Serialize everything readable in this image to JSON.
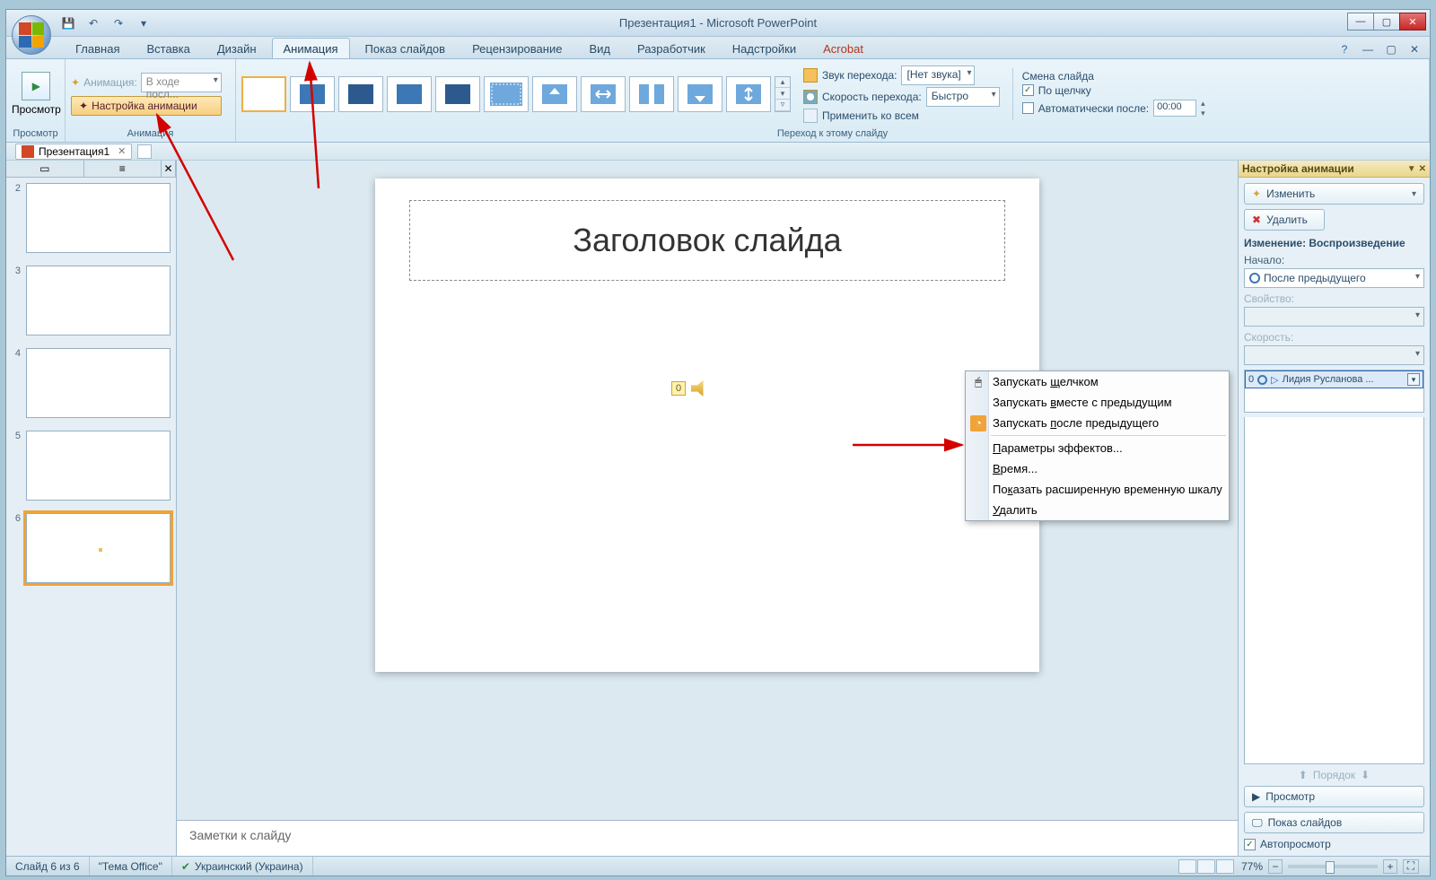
{
  "titlebar": {
    "title": "Презентация1 - Microsoft PowerPoint"
  },
  "qat": {
    "save": "save-icon",
    "undo": "undo-icon",
    "redo": "redo-icon",
    "repeat": "repeat-icon"
  },
  "tabs": {
    "home": "Главная",
    "insert": "Вставка",
    "design": "Дизайн",
    "animation": "Анимация",
    "slideshow": "Показ слайдов",
    "review": "Рецензирование",
    "view": "Вид",
    "developer": "Разработчик",
    "addins": "Надстройки",
    "acrobat": "Acrobat"
  },
  "ribbon": {
    "preview_grp": "Просмотр",
    "preview_btn": "Просмотр",
    "anim_grp": "Анимация",
    "anim_label": "Анимация:",
    "anim_value": "В ходе посл...",
    "custom_anim": "Настройка анимации",
    "transition_grp": "Переход к этому слайду",
    "sound_label": "Звук перехода:",
    "sound_value": "[Нет звука]",
    "speed_label": "Скорость перехода:",
    "speed_value": "Быстро",
    "apply_all": "Применить ко всем",
    "advance_grp": "Смена слайда",
    "on_click": "По щелчку",
    "auto_after": "Автоматически после:",
    "auto_time": "00:00"
  },
  "doctab": {
    "name": "Презентация1"
  },
  "thumbs": {
    "items": [
      "2",
      "3",
      "4",
      "5",
      "6"
    ]
  },
  "slide": {
    "title": "Заголовок слайда",
    "media_index": "0"
  },
  "notes": {
    "placeholder": "Заметки к слайду"
  },
  "taskpane": {
    "title": "Настройка анимации",
    "change_btn": "Изменить",
    "delete_btn": "Удалить",
    "mod_title": "Изменение: Воспроизведение",
    "start_label": "Начало:",
    "start_value": "После предыдущего",
    "prop_label": "Свойство:",
    "speed_label": "Скорость:",
    "list_item_index": "0",
    "list_item_text": "Лидия Русланова ...",
    "order_label": "Порядок",
    "play_btn": "Просмотр",
    "slideshow_btn": "Показ слайдов",
    "autopreview": "Автопросмотр"
  },
  "context_menu": {
    "on_click": "Запускать щелчком",
    "with_prev": "Запускать вместе с предыдущим",
    "after_prev": "Запускать после предыдущего",
    "effect_opts": "Параметры эффектов...",
    "timing": "Время...",
    "ext_timeline": "Показать расширенную временную шкалу",
    "remove": "Удалить"
  },
  "status": {
    "slide_of": "Слайд 6 из 6",
    "theme": "\"Тема Office\"",
    "lang": "Украинский (Украина)",
    "zoom": "77%"
  }
}
